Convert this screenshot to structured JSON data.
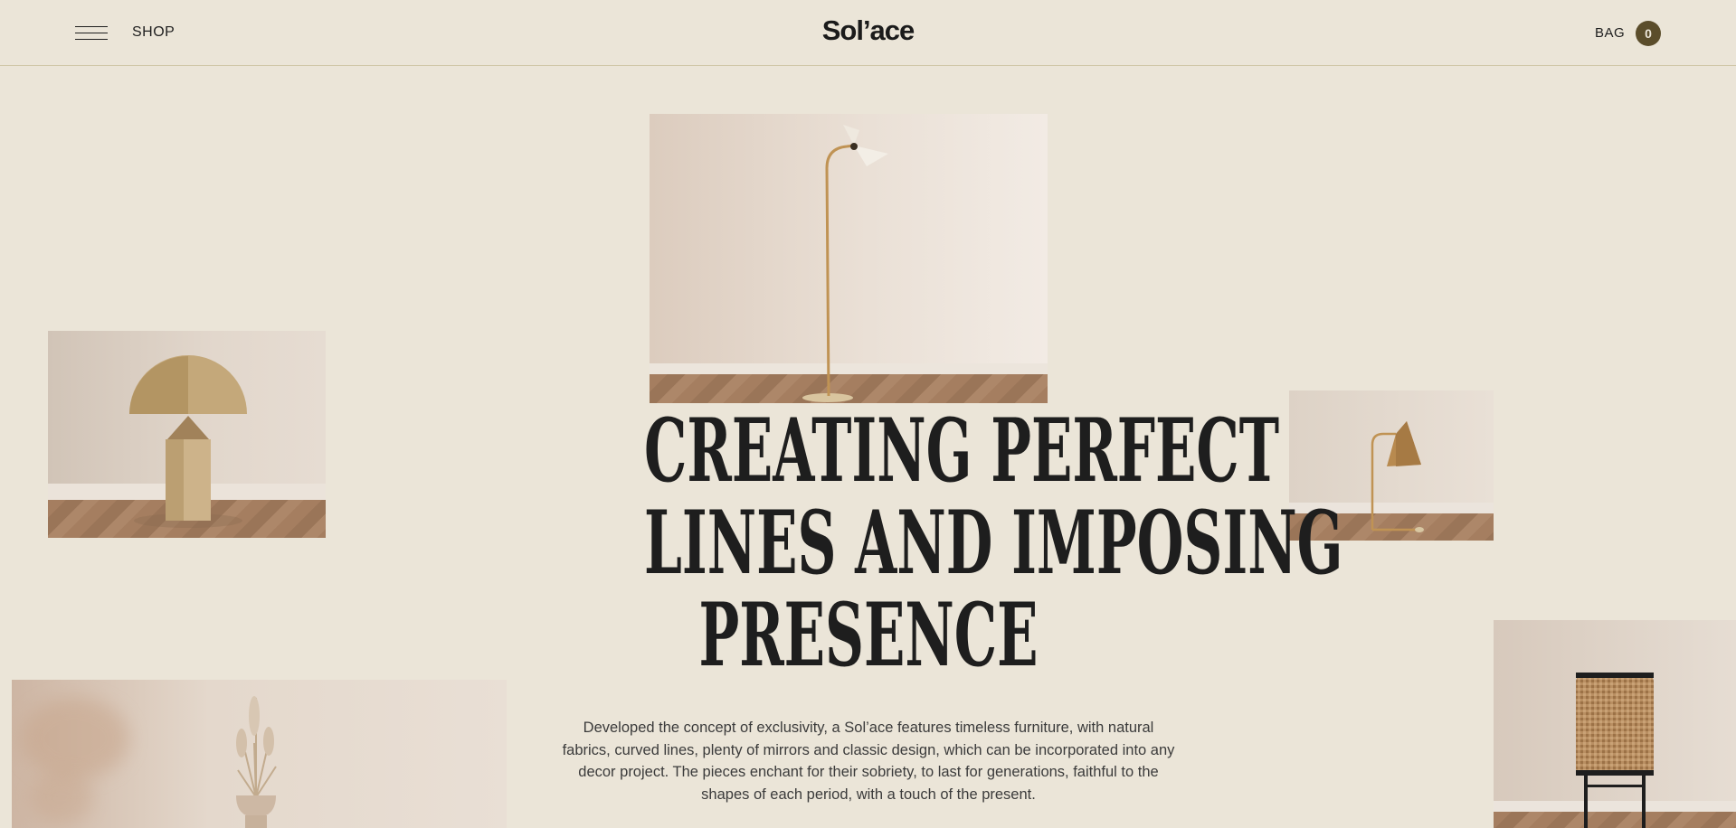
{
  "header": {
    "menu_icon": "hamburger-menu-icon",
    "shop_label": "SHOP",
    "logo_text": "Sol’ace",
    "bag_label": "BAG",
    "bag_count": "0"
  },
  "hero": {
    "headline_lines": [
      "CREATING PERFECT",
      "LINES AND IMPOSING",
      "PRESENCE"
    ],
    "description": "Developed the concept of exclusivity, a Sol’ace features timeless furniture, with natural fabrics, curved lines, plenty of mirrors and classic design, which can be incorporated into any decor project. The pieces enchant for their sobriety, to last for generations, faithful to the shapes of each period, with a touch of the present."
  },
  "colors": {
    "background": "#ebe5d8",
    "text": "#1e1e1e",
    "accent": "#5b4d2b",
    "divider": "#cfc6a6"
  }
}
